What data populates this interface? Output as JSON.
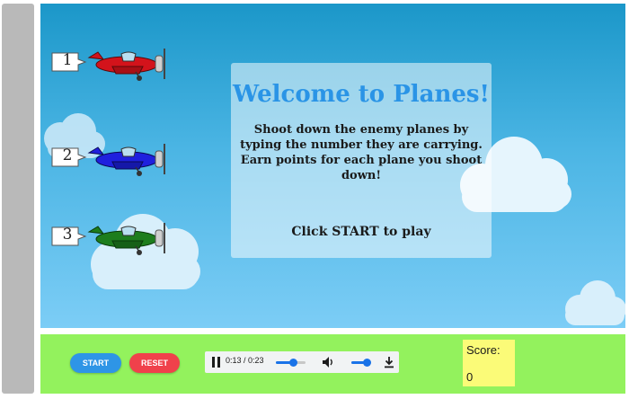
{
  "welcome": {
    "title": "Welcome to Planes!",
    "description": "Shoot down the enemy planes by typing the number they are carrying. Earn points for each plane you shoot down!",
    "cta": "Click START to play"
  },
  "planes": [
    {
      "number": "1",
      "color": "#d3131b"
    },
    {
      "number": "2",
      "color": "#1f20de"
    },
    {
      "number": "3",
      "color": "#1d7d1d"
    }
  ],
  "controls": {
    "start_label": "START",
    "reset_label": "RESET",
    "audio": {
      "time": "0:13 / 0:23",
      "progress": 0.565,
      "volume": 0.75
    },
    "score_label": "Score:",
    "score_value": "0"
  },
  "colors": {
    "sky_top": "#1b97c9",
    "sky_bottom": "#7ccdf6",
    "control_bar": "#93f25d",
    "score_box": "#fbfb78",
    "start_button": "#2e95e6",
    "reset_button": "#f0414b",
    "title": "#2a94e6"
  },
  "icons": [
    "pause-icon",
    "volume-icon",
    "download-icon"
  ]
}
